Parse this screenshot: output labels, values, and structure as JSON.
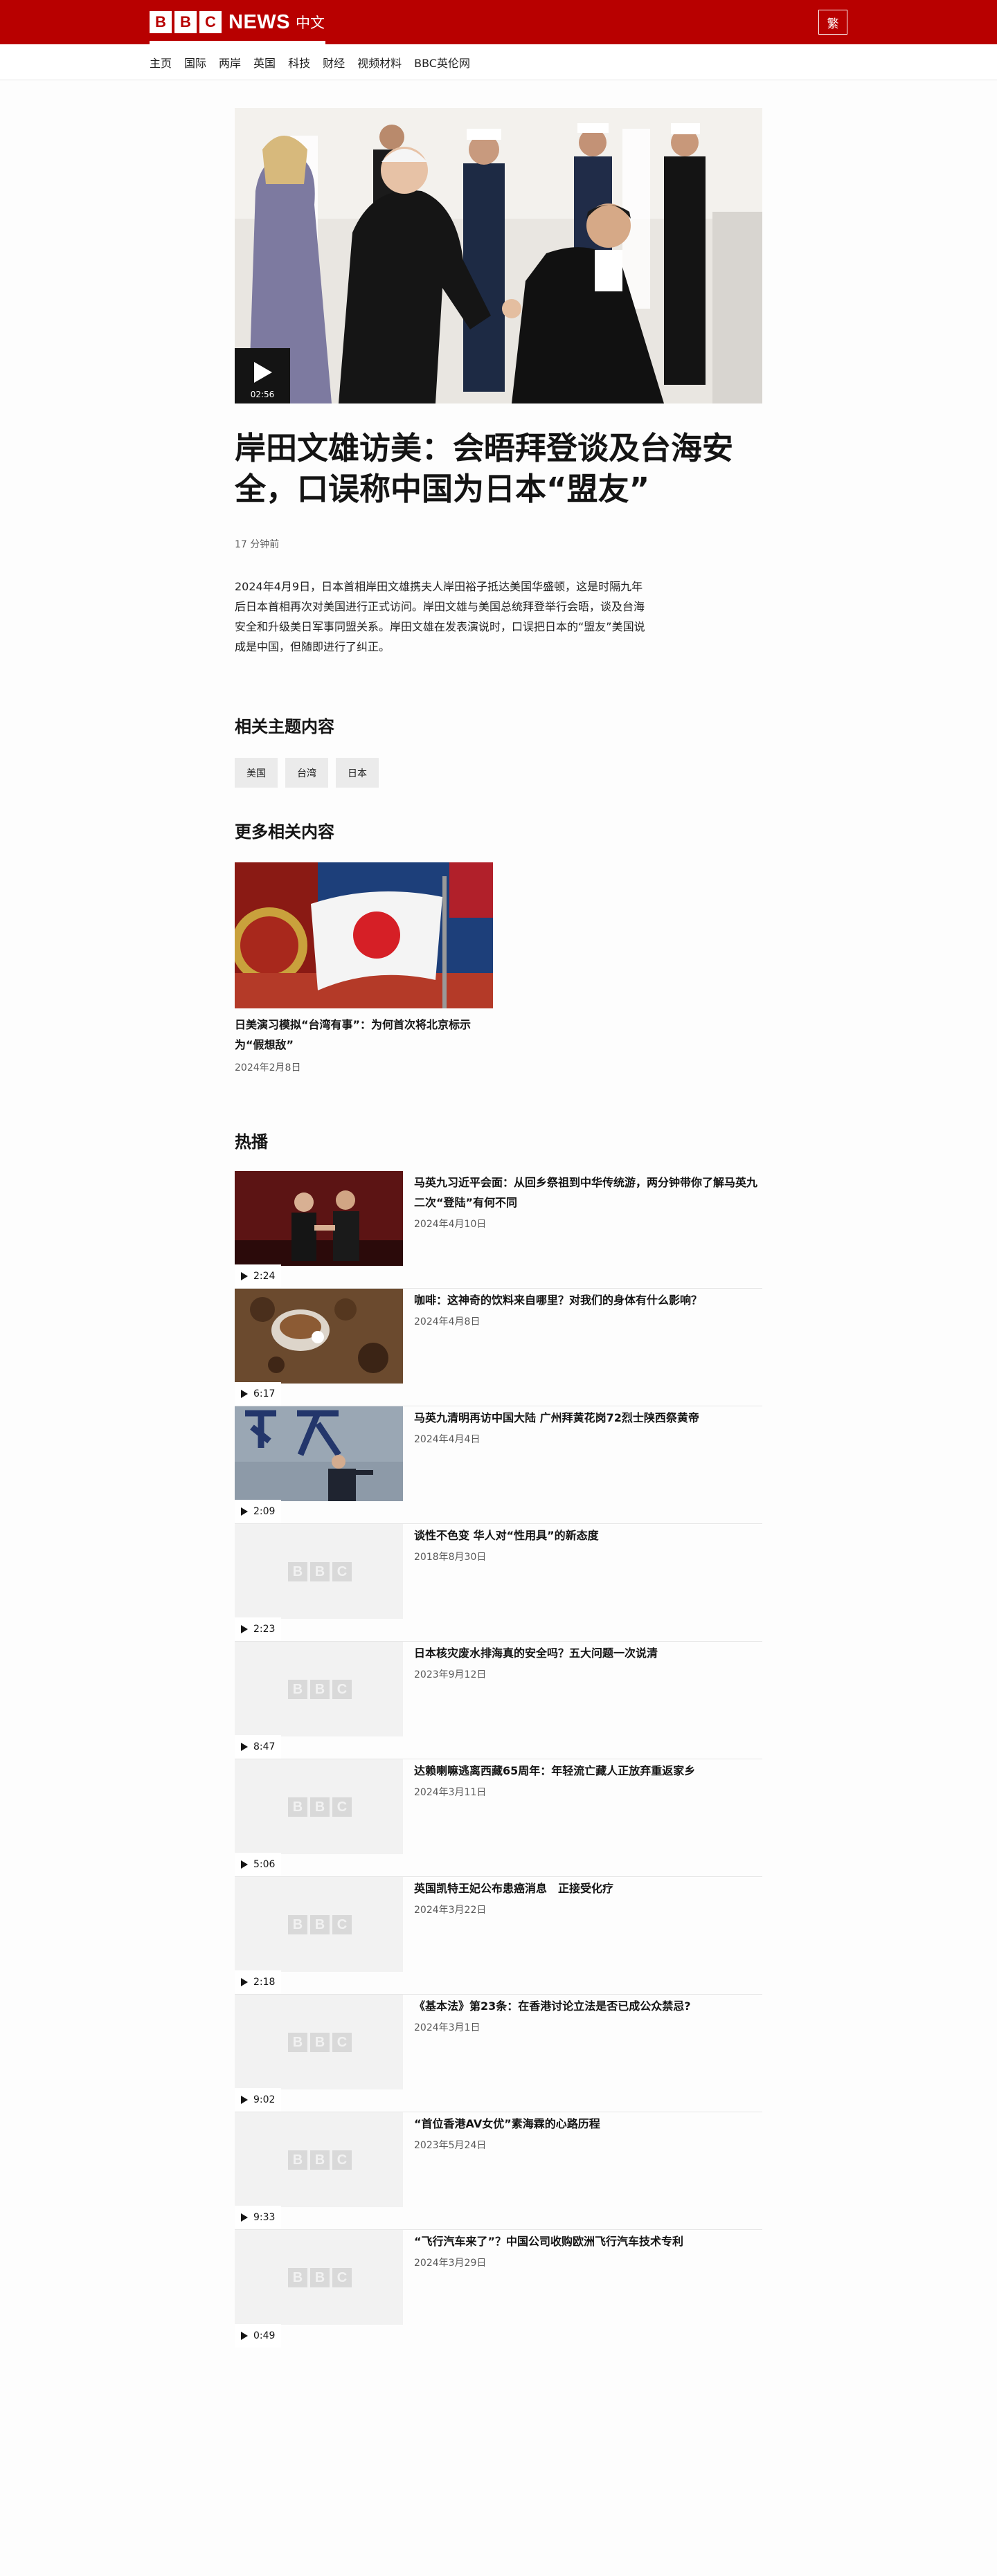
{
  "header": {
    "logo_letters": [
      "B",
      "B",
      "C"
    ],
    "logo_news": "NEWS",
    "logo_lang": "中文",
    "trad_button": "繁",
    "colors": {
      "brand": "#b80000"
    }
  },
  "nav": {
    "items": [
      "主页",
      "国际",
      "两岸",
      "英国",
      "科技",
      "财经",
      "视频材料",
      "BBC英伦网"
    ]
  },
  "hero": {
    "duration": "02:56",
    "play_icon": "play-icon"
  },
  "article": {
    "headline": "岸田文雄访美：会晤拜登谈及台海安全，口误称中国为日本“盟友”",
    "timestamp": "17 分钟前",
    "summary": "2024年4月9日，日本首相岸田文雄携夫人岸田裕子抵达美国华盛顿，这是时隔九年后日本首相再次对美国进行正式访问。岸田文雄与美国总统拜登举行会晤，谈及台海安全和升级美日军事同盟关系。岸田文雄在发表演说时，口误把日本的“盟友”美国说成是中国，但随即进行了纠正。"
  },
  "topics": {
    "title": "相关主题内容",
    "tags": [
      "美国",
      "台湾",
      "日本"
    ]
  },
  "more": {
    "title": "更多相关内容",
    "card": {
      "title": "日美演习模拟“台湾有事”：为何首次将北京标示为“假想敌”",
      "date": "2024年2月8日"
    }
  },
  "popular": {
    "title": "热播",
    "items": [
      {
        "title": "马英九习近平会面：从回乡祭祖到中华传统游，两分钟带你了解马英九二次“登陆”有何不同",
        "date": "2024年4月10日",
        "duration": "2:24"
      },
      {
        "title": "咖啡：这神奇的饮料来自哪里？对我们的身体有什么影响？",
        "date": "2024年4月8日",
        "duration": "6:17"
      },
      {
        "title": "马英九清明再访中国大陆 广州拜黄花岗72烈士陕西祭黄帝",
        "date": "2024年4月4日",
        "duration": "2:09"
      },
      {
        "title": "谈性不色变 华人对“性用具”的新态度",
        "date": "2018年8月30日",
        "duration": "2:23"
      },
      {
        "title": "日本核灾废水排海真的安全吗？五大问题一次说清",
        "date": "2023年9月12日",
        "duration": "8:47"
      },
      {
        "title": "达赖喇嘛逃离西藏65周年：年轻流亡藏人正放弃重返家乡",
        "date": "2024年3月11日",
        "duration": "5:06"
      },
      {
        "title": "英国凯特王妃公布患癌消息　正接受化疗",
        "date": "2024年3月22日",
        "duration": "2:18"
      },
      {
        "title": "《基本法》第23条：在香港讨论立法是否已成公众禁忌?",
        "date": "2024年3月1日",
        "duration": "9:02"
      },
      {
        "title": "“首位香港AV女优”素海霖的心路历程",
        "date": "2023年5月24日",
        "duration": "9:33"
      },
      {
        "title": "“飞行汽车来了”？中国公司收购欧洲飞行汽车技术专利",
        "date": "2024年3月29日",
        "duration": "0:49"
      }
    ]
  }
}
